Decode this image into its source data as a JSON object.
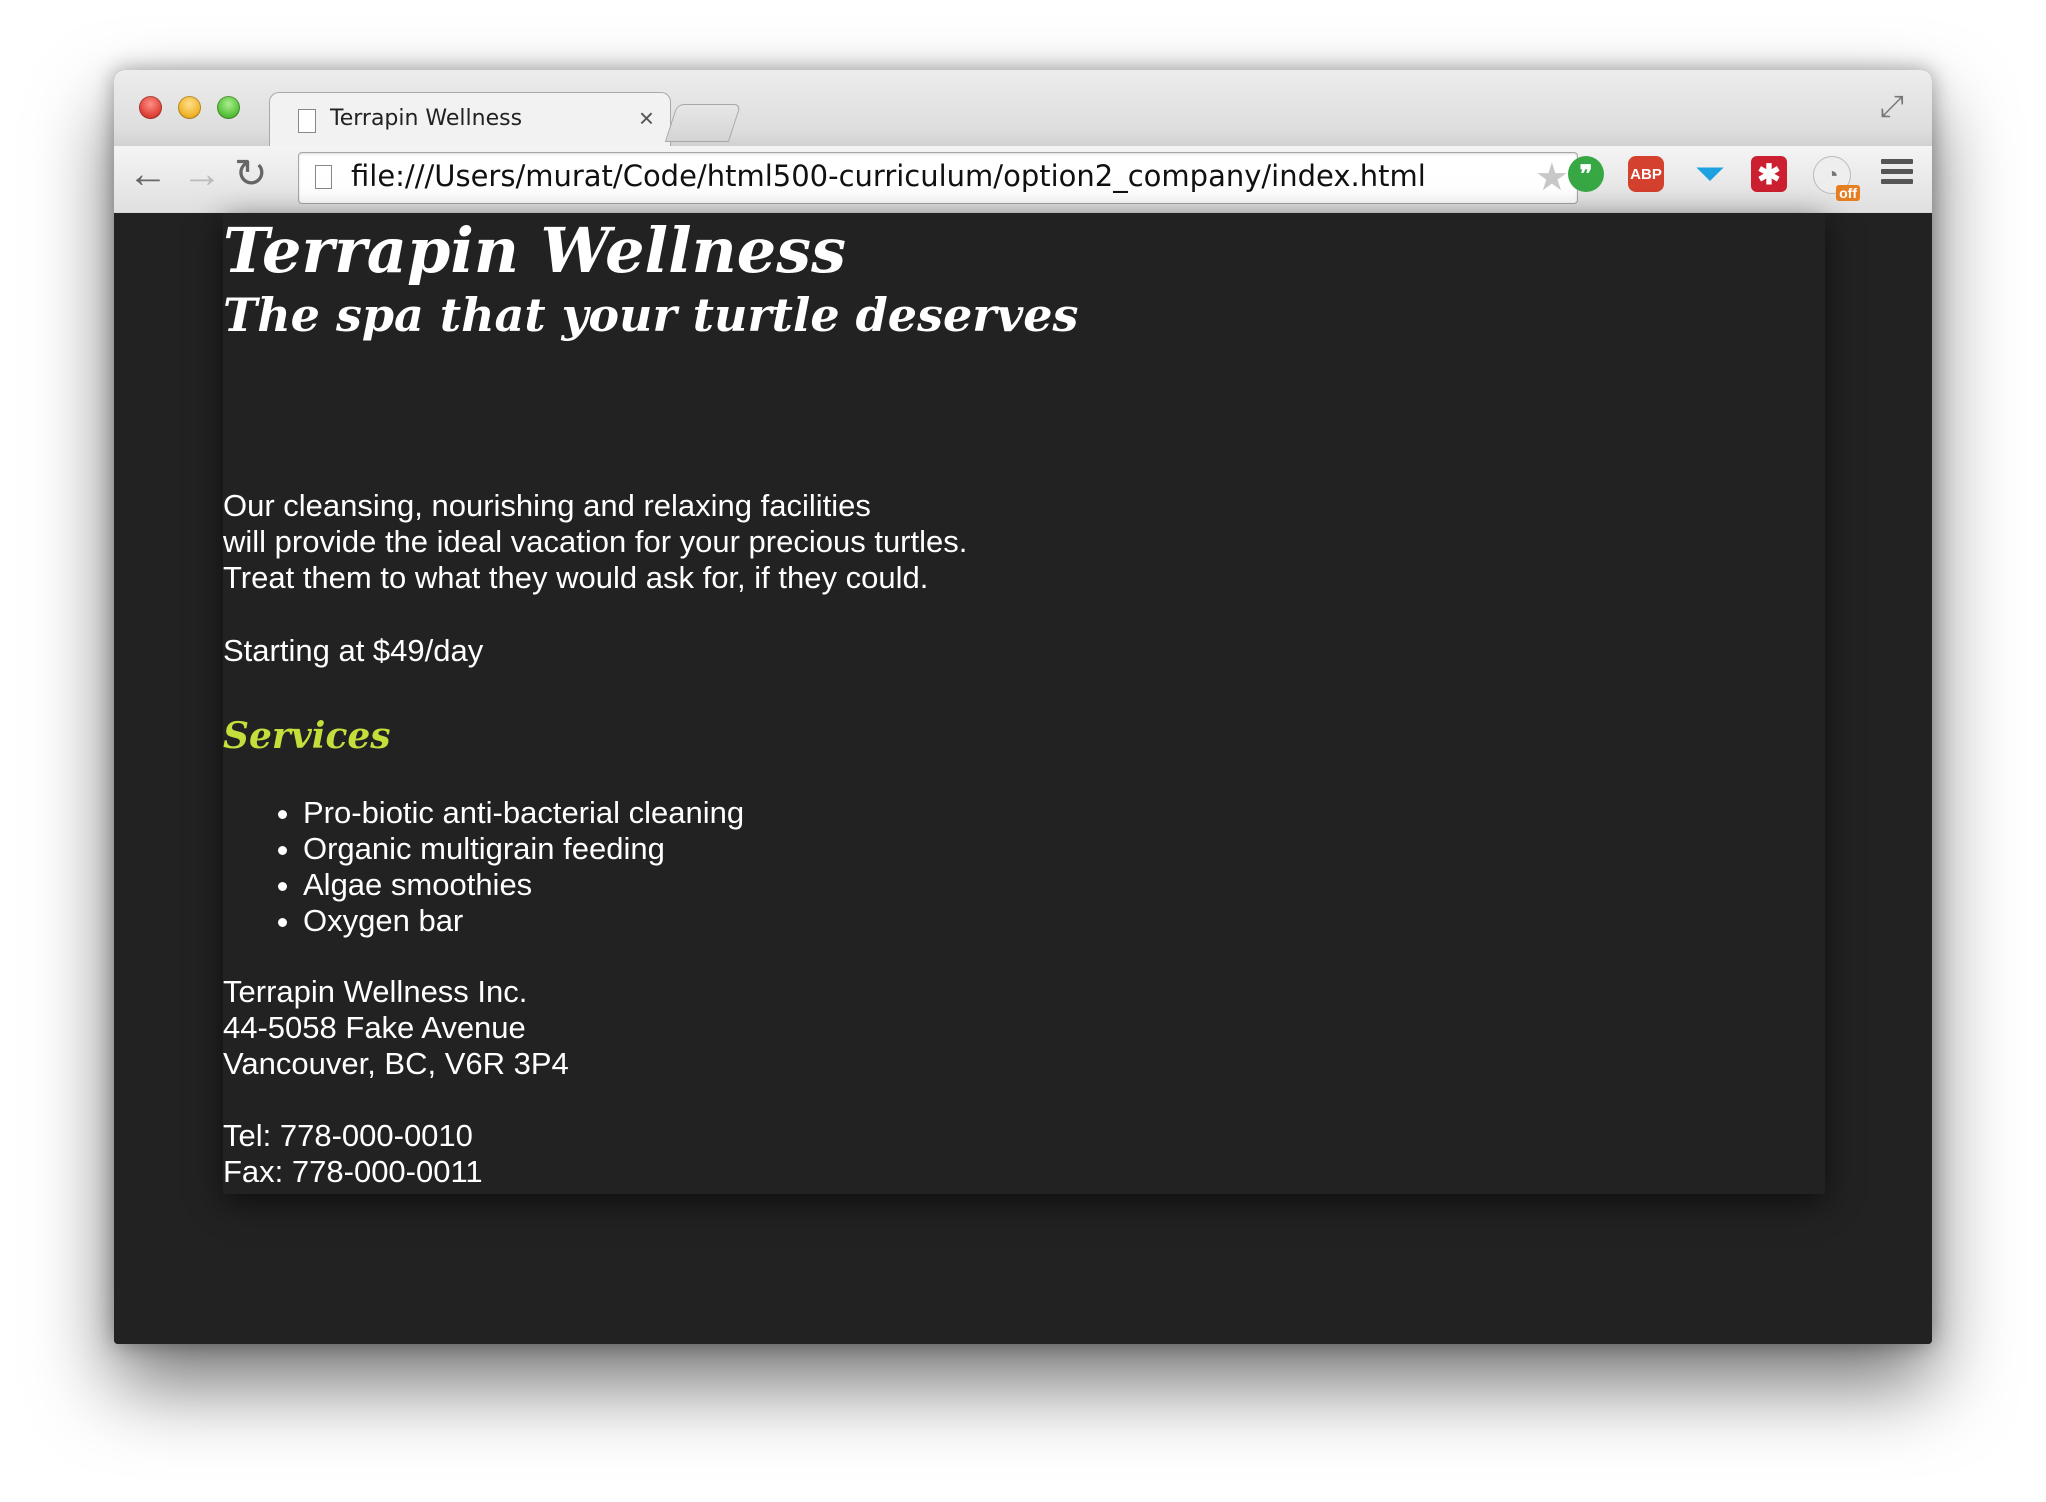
{
  "browser": {
    "tab_title": "Terrapin Wellness",
    "tab_close": "×",
    "url": "file:///Users/murat/Code/html500-curriculum/option2_company/index.html",
    "nav": {
      "back": "←",
      "forward": "→",
      "reload": "↻"
    },
    "bookmark_star": "★",
    "fullscreen_icon": "⤢",
    "extensions": {
      "hangouts": "❞",
      "adblock": "ABP",
      "funnel": "⏷",
      "lastpass": "✱",
      "ghostery": "◔",
      "ghostery_badge": "off"
    },
    "colors": {
      "close": "#e0443a",
      "minimize": "#f1b52e",
      "zoom": "#59c23b"
    }
  },
  "page": {
    "title": "Terrapin Wellness",
    "tagline": "The spa that your turtle deserves",
    "description": [
      "Our cleansing, nourishing and relaxing facilities",
      "will provide the ideal vacation for your precious turtles.",
      "Treat them to what they would ask for, if they could."
    ],
    "price": "Starting at $49/day",
    "services_heading": "Services",
    "services": [
      "Pro-biotic anti-bacterial cleaning",
      "Organic multigrain feeding",
      "Algae smoothies",
      "Oxygen bar"
    ],
    "address": [
      "Terrapin Wellness Inc.",
      "44-5058 Fake Avenue",
      "Vancouver, BC, V6R 3P4"
    ],
    "contact": [
      "Tel: 778-000-0010",
      "Fax: 778-000-0011"
    ],
    "colors": {
      "background": "#222222",
      "text": "#ffffff",
      "accent": "#c4de3b"
    }
  }
}
